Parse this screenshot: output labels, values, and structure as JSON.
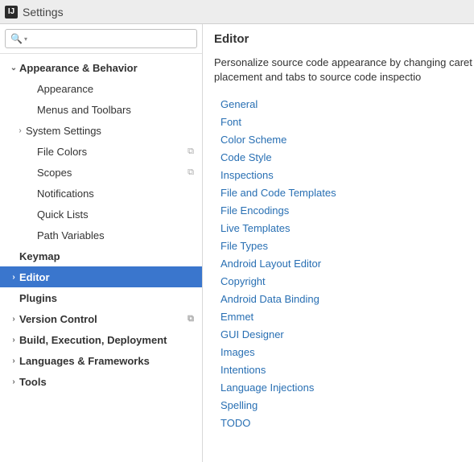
{
  "titlebar": {
    "app_icon_text": "IJ",
    "title": "Settings"
  },
  "search": {
    "placeholder": "",
    "value": ""
  },
  "sidebar": {
    "items": [
      {
        "label": "Appearance & Behavior",
        "depth": 0,
        "arrow": "down",
        "selected": false,
        "trail": ""
      },
      {
        "label": "Appearance",
        "depth": 1,
        "arrow": "",
        "selected": false,
        "trail": ""
      },
      {
        "label": "Menus and Toolbars",
        "depth": 1,
        "arrow": "",
        "selected": false,
        "trail": ""
      },
      {
        "label": "System Settings",
        "depth": 1,
        "arrow": "right",
        "selected": false,
        "trail": ""
      },
      {
        "label": "File Colors",
        "depth": 1,
        "arrow": "",
        "selected": false,
        "trail": "project"
      },
      {
        "label": "Scopes",
        "depth": 1,
        "arrow": "",
        "selected": false,
        "trail": "project"
      },
      {
        "label": "Notifications",
        "depth": 1,
        "arrow": "",
        "selected": false,
        "trail": ""
      },
      {
        "label": "Quick Lists",
        "depth": 1,
        "arrow": "",
        "selected": false,
        "trail": ""
      },
      {
        "label": "Path Variables",
        "depth": 1,
        "arrow": "",
        "selected": false,
        "trail": ""
      },
      {
        "label": "Keymap",
        "depth": 0,
        "arrow": "",
        "selected": false,
        "trail": ""
      },
      {
        "label": "Editor",
        "depth": 0,
        "arrow": "right",
        "selected": true,
        "trail": ""
      },
      {
        "label": "Plugins",
        "depth": 0,
        "arrow": "",
        "selected": false,
        "trail": ""
      },
      {
        "label": "Version Control",
        "depth": 0,
        "arrow": "right",
        "selected": false,
        "trail": "project"
      },
      {
        "label": "Build, Execution, Deployment",
        "depth": 0,
        "arrow": "right",
        "selected": false,
        "trail": ""
      },
      {
        "label": "Languages & Frameworks",
        "depth": 0,
        "arrow": "right",
        "selected": false,
        "trail": ""
      },
      {
        "label": "Tools",
        "depth": 0,
        "arrow": "right",
        "selected": false,
        "trail": ""
      }
    ]
  },
  "content": {
    "title": "Editor",
    "description": "Personalize source code appearance by changing caret placement and tabs to source code inspectio",
    "links": [
      "General",
      "Font",
      "Color Scheme",
      "Code Style",
      "Inspections",
      "File and Code Templates",
      "File Encodings",
      "Live Templates",
      "File Types",
      "Android Layout Editor",
      "Copyright",
      "Android Data Binding",
      "Emmet",
      "GUI Designer",
      "Images",
      "Intentions",
      "Language Injections",
      "Spelling",
      "TODO"
    ]
  }
}
